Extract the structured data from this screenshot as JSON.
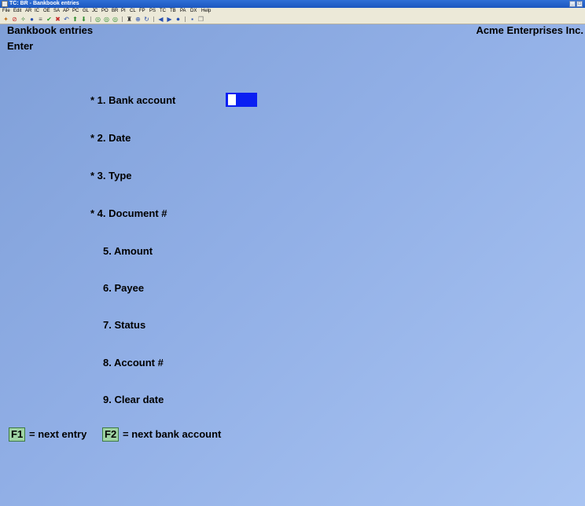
{
  "window": {
    "title": "TC: BR - Bankbook entries"
  },
  "menu": [
    "File",
    "Edit",
    "AR",
    "IC",
    "OE",
    "SA",
    "AP",
    "PC",
    "GL",
    "JC",
    "PO",
    "BR",
    "PI",
    "CL",
    "FP",
    "PS",
    "TC",
    "TB",
    "PA",
    "DX",
    "Help"
  ],
  "toolbar_icons": [
    "exit-icon",
    "stop-icon",
    "find-icon",
    "help-icon",
    "print-icon",
    "check-icon",
    "cancel-icon",
    "undo-icon",
    "up-arrow-icon",
    "down-arrow-icon",
    "first-icon",
    "previous-icon",
    "next-icon",
    "binoculars-icon",
    "zoom-icon",
    "refresh-icon",
    "left-arrow-icon",
    "right-arrow-icon",
    "stop-circle-icon",
    "save-icon",
    "copy-icon"
  ],
  "screen": {
    "program_title": "Bankbook entries",
    "company": "Acme Enterprises Inc.",
    "mode": "Enter"
  },
  "fields": [
    {
      "label": "* 1. Bank account"
    },
    {
      "label": "* 2. Date"
    },
    {
      "label": "* 3. Type"
    },
    {
      "label": "* 4. Document #"
    },
    {
      "label": "5. Amount"
    },
    {
      "label": "6. Payee"
    },
    {
      "label": "7. Status"
    },
    {
      "label": "8. Account #"
    },
    {
      "label": "9. Clear date"
    }
  ],
  "bank_account_input": {
    "value": ""
  },
  "fkeys": {
    "f1_key": "F1",
    "f1_text": "= next entry",
    "f2_key": "F2",
    "f2_text": "= next bank account"
  },
  "colors": {
    "input_field": "#0a1ff2",
    "fkey_bg": "#9fd3a3",
    "screen_bg": "#91afe6"
  }
}
